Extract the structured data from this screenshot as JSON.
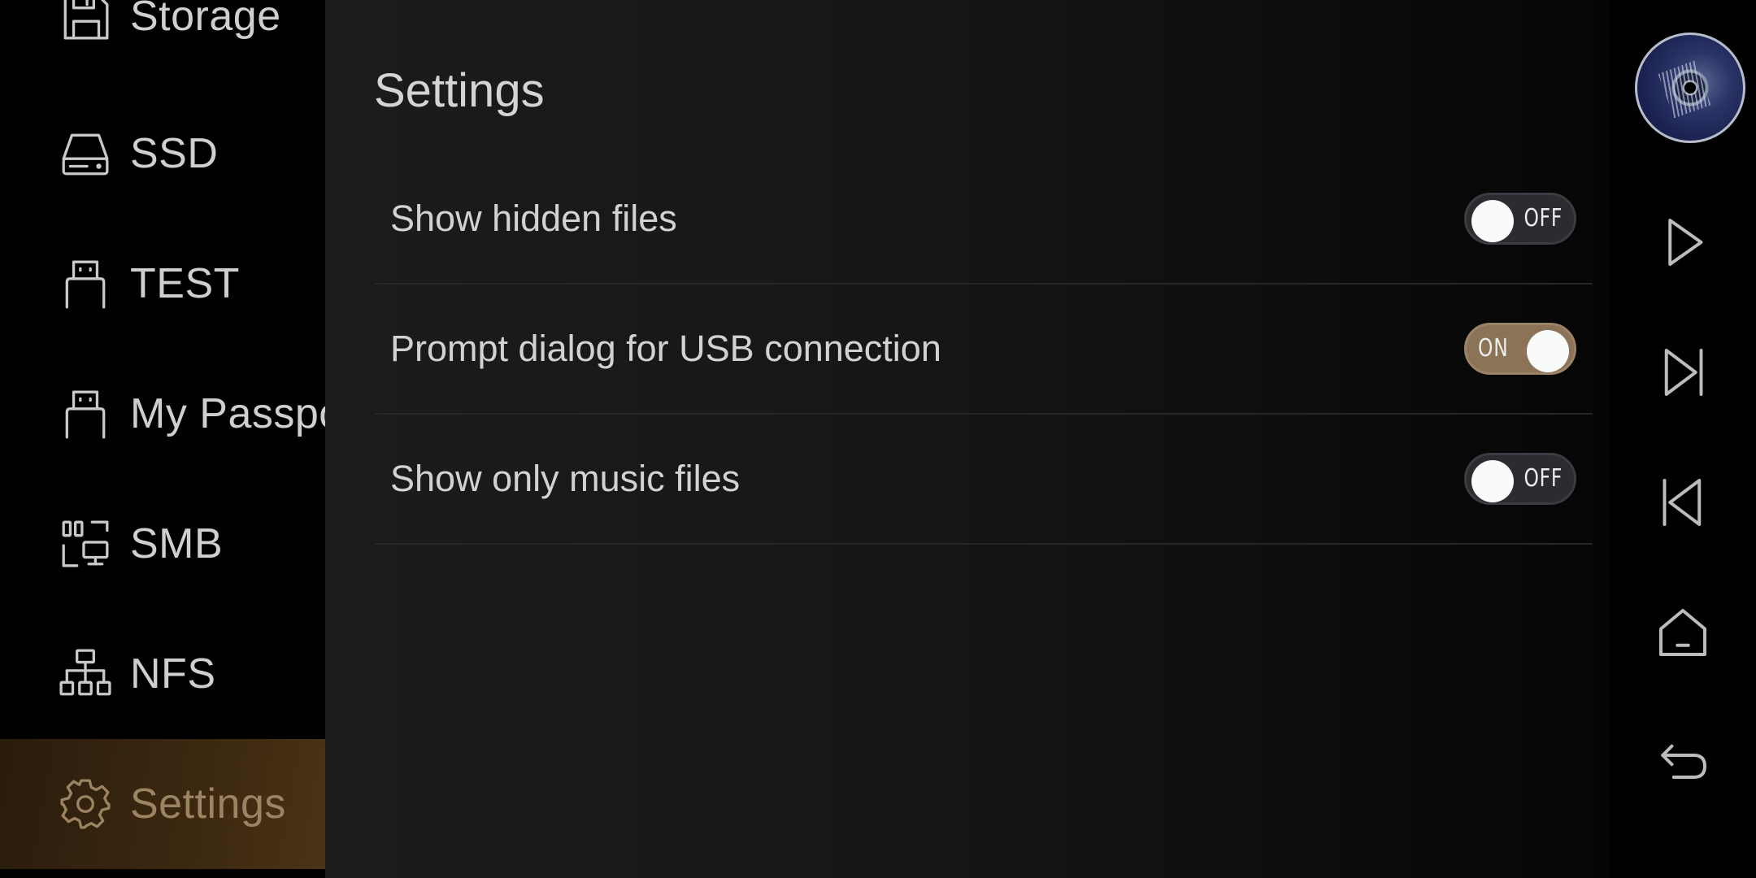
{
  "sidebar": {
    "items": [
      {
        "label": "Storage",
        "icon": "floppy-disk-icon"
      },
      {
        "label": "SSD",
        "icon": "ssd-drive-icon"
      },
      {
        "label": "TEST",
        "icon": "usb-drive-icon"
      },
      {
        "label": "My Passport",
        "icon": "usb-drive-icon"
      },
      {
        "label": "SMB",
        "icon": "network-share-icon"
      },
      {
        "label": "NFS",
        "icon": "network-tree-icon"
      },
      {
        "label": "Settings",
        "icon": "gear-icon",
        "active": true
      }
    ]
  },
  "main": {
    "title": "Settings",
    "settings": [
      {
        "label": "Show hidden files",
        "state": "OFF"
      },
      {
        "label": "Prompt dialog for USB connection",
        "state": "ON"
      },
      {
        "label": "Show only music files",
        "state": "OFF"
      }
    ]
  },
  "controls": {
    "icons": [
      "album-art",
      "play-icon",
      "next-track-icon",
      "previous-track-icon",
      "home-icon",
      "back-icon"
    ]
  },
  "colors": {
    "accent": "#9c8462",
    "toggle_on": "#8a7356",
    "toggle_off": "#2b2b30",
    "background": "#000000"
  }
}
